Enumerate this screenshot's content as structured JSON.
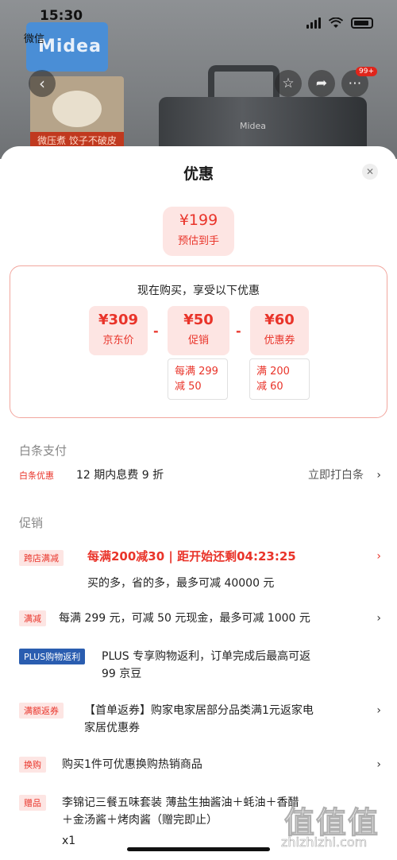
{
  "status_bar": {
    "time": "15:30",
    "back_app": "微信"
  },
  "product_bg": {
    "brand": "Midea",
    "thumb_caption": "微压煮 饺子不破皮",
    "cooker_logo": "Midea",
    "badge": "99+"
  },
  "sheet": {
    "title": "优惠",
    "estimate": {
      "price": "¥199",
      "label": "预估到手"
    },
    "breakdown": {
      "title": "现在购买，享受以下优惠",
      "items": [
        {
          "value": "¥309",
          "label": "京东价"
        },
        {
          "value": "¥50",
          "label": "促销",
          "condition_line1": "每满 299",
          "condition_line2": "减 50"
        },
        {
          "value": "¥60",
          "label": "优惠券",
          "condition_line1": "满 200",
          "condition_line2": "减 60"
        }
      ],
      "minus": "-"
    },
    "baitiao": {
      "section": "白条支付",
      "tag": "白条优惠",
      "text": "12 期内息费 9 折",
      "action": "立即打白条"
    },
    "promo": {
      "section": "促销",
      "items": [
        {
          "tag": "跨店满减",
          "headline": "每满200减30 | 距开始还剩04:23:25",
          "text": "买的多，省的多，最多可减 40000 元"
        },
        {
          "tag": "满减",
          "text": "每满 299 元，可减 50 元现金，最多可减 1000 元"
        },
        {
          "tag": "PLUS购物返利",
          "text_line1": "PLUS 专享购物返利，订单完成后最高可返",
          "text_line2": "99 京豆"
        },
        {
          "tag": "满额返券",
          "text_line1": "【首单返券】购家电家居部分品类满1元返家电",
          "text_line2": "家居优惠券"
        },
        {
          "tag": "换购",
          "text": "购买1件可优惠换购热销商品"
        },
        {
          "tag": "赠品",
          "text_line1": "李锦记三餐五味套装 薄盐生抽酱油＋蚝油＋香醋",
          "text_line2": "＋金汤酱＋烤肉酱（赠完即止）",
          "text_line3": "x1"
        }
      ]
    }
  },
  "watermark": {
    "logo": "值值值",
    "url": "zhizhizhi.com"
  }
}
